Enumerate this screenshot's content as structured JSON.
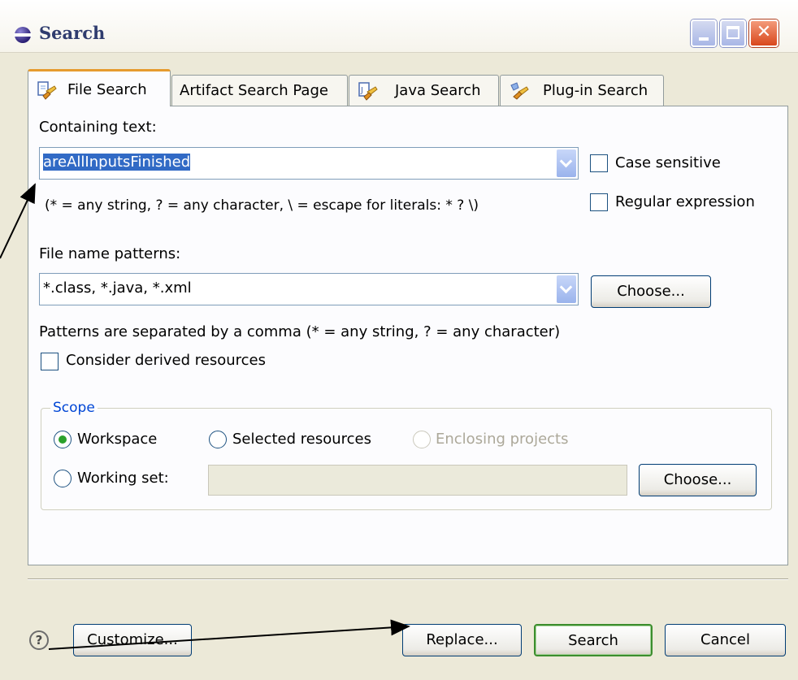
{
  "window": {
    "title": "Search"
  },
  "tabs": [
    {
      "label": "File Search",
      "icon": "file-search-icon",
      "active": true
    },
    {
      "label": "Artifact Search Page",
      "active": false
    },
    {
      "label": "Java Search",
      "icon": "java-search-icon",
      "active": false
    },
    {
      "label": "Plug-in Search",
      "icon": "plugin-search-icon",
      "active": false
    }
  ],
  "containing": {
    "label": "Containing text:",
    "value": "areAllInputsFinished",
    "hint": "(* = any string, ? = any character, \\ = escape for literals: * ? \\)",
    "case_sensitive_label": "Case sensitive",
    "case_sensitive": false,
    "regex_label": "Regular expression",
    "regex": false
  },
  "file_patterns": {
    "label": "File name patterns:",
    "value": "*.class, *.java, *.xml",
    "choose_label": "Choose...",
    "hint": "Patterns are separated by a comma (* = any string, ? = any character)",
    "derived_label": "Consider derived resources",
    "derived": false
  },
  "scope": {
    "title": "Scope",
    "workspace_label": "Workspace",
    "selected_label": "Selected resources",
    "enclosing_label": "Enclosing projects",
    "working_set_label": "Working set:",
    "working_set_value": "",
    "choose_label": "Choose...",
    "selected": "Workspace"
  },
  "footer": {
    "customize_label": "Customize...",
    "replace_label": "Replace...",
    "search_label": "Search",
    "cancel_label": "Cancel"
  },
  "colors": {
    "accent_tab": "#e69b2e",
    "selection": "#316ac5",
    "default_button": "#3c8e2e",
    "group_title": "#0046d5"
  }
}
